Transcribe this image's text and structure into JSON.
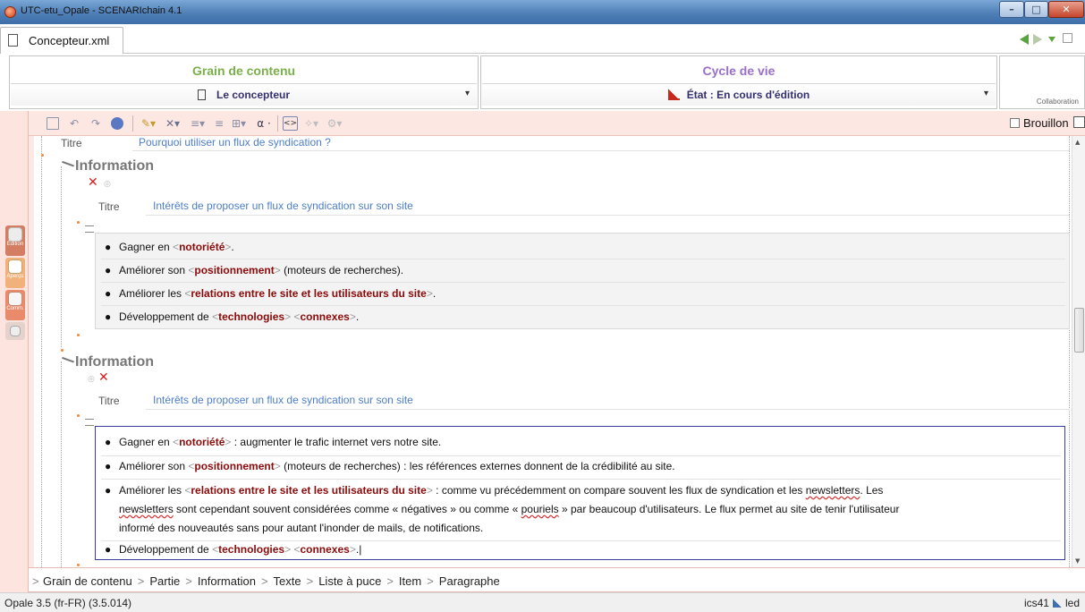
{
  "window": {
    "title": "UTC-etu_Opale - SCENARIchain 4.1",
    "min_label": "–",
    "max_label": "□",
    "close_label": "✕"
  },
  "tab": {
    "label": "Concepteur.xml"
  },
  "header": {
    "grain": {
      "title": "Grain de contenu",
      "value": "Le concepteur"
    },
    "cycle": {
      "title": "Cycle de vie",
      "value": "État : En cours d'édition"
    },
    "collab": {
      "label": "Collaboration"
    }
  },
  "sidebar": {
    "edition": "Édition",
    "apercu": "Aperçu",
    "comm": "Comm."
  },
  "toolbar": {
    "alpha": "α ·",
    "code": "<>",
    "brouillon": "Brouillon"
  },
  "document": {
    "titre_label": "Titre",
    "top_titre": "Pourquoi utiliser un flux de syndication ?",
    "info_heading": "Information",
    "section1": {
      "titre": "Intérêts de proposer un flux de syndication sur son site",
      "items": [
        {
          "pre": "Gagner en ",
          "kw": "notoriété",
          "post": "."
        },
        {
          "pre": "Améliorer son ",
          "kw": "positionnement",
          "post": " (moteurs de recherches)."
        },
        {
          "pre": "Améliorer les ",
          "kw": "relations entre le site et les utilisateurs du site",
          "post": "."
        }
      ],
      "item4": {
        "pre": "Développement de ",
        "kw1": "technologies",
        "kw2": "connexes",
        "post": "."
      }
    },
    "section2": {
      "titre": "Intérêts de proposer un flux de syndication sur son site",
      "items": [
        {
          "pre": "Gagner en ",
          "kw": "notoriété",
          "post": " : augmenter le trafic internet vers notre site."
        },
        {
          "pre": "Améliorer son ",
          "kw": "positionnement",
          "post": " (moteurs de recherches) : les références externes donnent de la crédibilité au site."
        }
      ],
      "item3": {
        "pre": "Améliorer les ",
        "kw": "relations entre le site et les utilisateurs du site",
        "post_a": " : comme vu précédemment on compare souvent les flux de syndication et les ",
        "sq1": "newsletters",
        "post_b": ". Les",
        "sq2": "newsletters",
        "post_c": " sont cependant souvent considérées comme « négatives » ou comme « ",
        "sq3": "pouriels",
        "post_d": " » par beaucoup d'utilisateurs. Le flux permet au site de tenir l'utilisateur",
        "line3": "informé des nouveautés sans pour autant l'inonder de mails, de notifications."
      },
      "item4": {
        "pre": "Développement de ",
        "kw1": "technologies",
        "kw2": "connexes",
        "post": "."
      }
    }
  },
  "breadcrumb": [
    "Grain de contenu",
    "Partie",
    "Information",
    "Texte",
    "Liste à puce",
    "Item",
    "Paragraphe"
  ],
  "status": {
    "left": "Opale 3.5 (fr-FR) (3.5.014)",
    "user": "ics41",
    "right_end": "led"
  }
}
